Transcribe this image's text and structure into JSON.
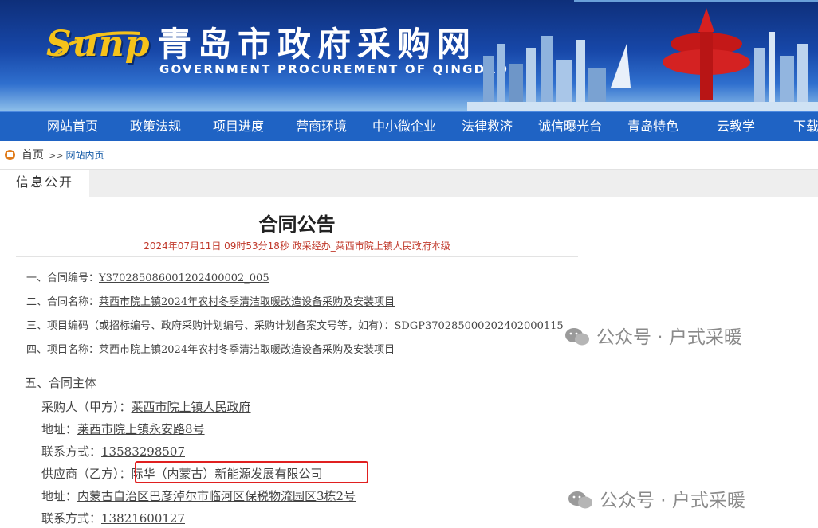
{
  "header": {
    "logo_text": "Sunp",
    "site_title": "青岛市政府采购网",
    "site_subtitle": "GOVERNMENT PROCUREMENT OF QINGDAO"
  },
  "nav": {
    "items": [
      "网站首页",
      "政策法规",
      "项目进度",
      "营商环境",
      "中小微企业",
      "法律救济",
      "诚信曝光台",
      "青岛特色",
      "云教学",
      "下载"
    ]
  },
  "breadcrumb": {
    "home": "首页",
    "separator": ">>",
    "current": "网站内页"
  },
  "tabs": {
    "active": "信息公开"
  },
  "article": {
    "title": "合同公告",
    "meta": "2024年07月11日 09时53分18秒 政采经办_莱西市院上镇人民政府本级",
    "items": [
      {
        "label": "一、合同编号：",
        "value": "Y370285086001202400002_005"
      },
      {
        "label": "二、合同名称：",
        "value": "莱西市院上镇2024年农村冬季清洁取暖改造设备采购及安装项目"
      },
      {
        "label": "三、项目编码（或招标编号、政府采购计划编号、采购计划备案文号等，如有）：",
        "value": "SDGP370285000202402000115"
      },
      {
        "label": "四、项目名称：",
        "value": "莱西市院上镇2024年农村冬季清洁取暖改造设备采购及安装项目"
      }
    ],
    "section5": {
      "heading": "五、合同主体",
      "fields": [
        {
          "label": "采购人（甲方）：",
          "value": "莱西市院上镇人民政府"
        },
        {
          "label": "地址：",
          "value": "莱西市院上镇永安路8号"
        },
        {
          "label": "联系方式：",
          "value": "13583298507"
        },
        {
          "label": "供应商（乙方）：",
          "value": "际华（内蒙古）新能源发展有限公司"
        },
        {
          "label": "地址：",
          "value": "内蒙古自治区巴彦淖尔市临河区保税物流园区3栋2号"
        },
        {
          "label": "联系方式：",
          "value": "13821600127"
        }
      ]
    }
  },
  "watermark": {
    "text": "公众号 · 户式采暖"
  },
  "colors": {
    "nav_bg": "#1f63c4",
    "meta_red": "#c0392b",
    "highlight_box": "#e02020"
  }
}
